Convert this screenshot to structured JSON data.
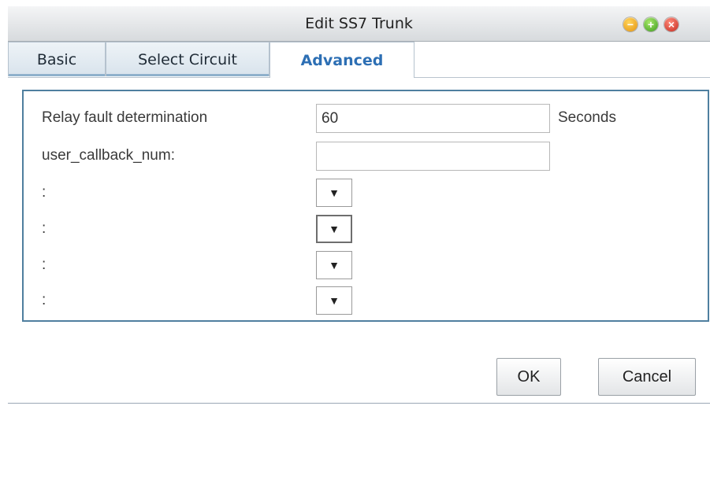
{
  "window": {
    "title": "Edit SS7 Trunk",
    "controls": [
      "minimize-icon",
      "maximize-icon",
      "close-icon"
    ]
  },
  "tabs": [
    {
      "label": "Basic",
      "active": false
    },
    {
      "label": "Select Circuit",
      "active": false
    },
    {
      "label": "Advanced",
      "active": true
    }
  ],
  "form": {
    "relay_fault": {
      "label": "Relay fault determination",
      "value": "60",
      "unit": "Seconds"
    },
    "user_callback": {
      "label": "user_callback_num:",
      "value": ""
    },
    "selects": [
      {
        "label": ":",
        "value": "",
        "arrow": "▼"
      },
      {
        "label": ":",
        "value": "",
        "arrow": "▼"
      },
      {
        "label": ":",
        "value": "",
        "arrow": "▼"
      },
      {
        "label": ":",
        "value": "",
        "arrow": "▼"
      }
    ]
  },
  "buttons": {
    "ok": "OK",
    "cancel": "Cancel"
  },
  "colors": {
    "active_tab_text": "#2d6fb4",
    "panel_border": "#4f7f9f",
    "minimize": "#e3920e",
    "maximize": "#3b9a1c",
    "close": "#c3271c"
  }
}
